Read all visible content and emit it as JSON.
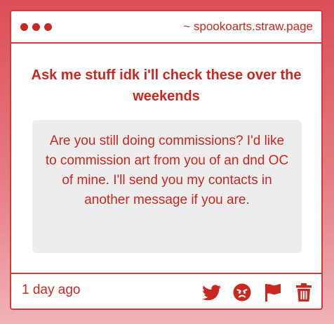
{
  "window": {
    "url_text": "~ spookoarts.straw.page"
  },
  "main": {
    "heading": "Ask me stuff idk i'll check these over the weekends",
    "question": "Are you still doing commissions? I'd like to commission art from you of an dnd OC of mine. I'll send you my contacts in another message if you are."
  },
  "footer": {
    "timestamp": "1 day ago",
    "actions": [
      "twitter-icon",
      "angry-face-icon",
      "flag-icon",
      "trash-icon"
    ]
  },
  "colors": {
    "accent": "#c8281f",
    "border": "#d33a3a",
    "question_bg": "#eeeded",
    "background_top": "#dc4f57",
    "background_bottom": "#f0b3b7"
  }
}
